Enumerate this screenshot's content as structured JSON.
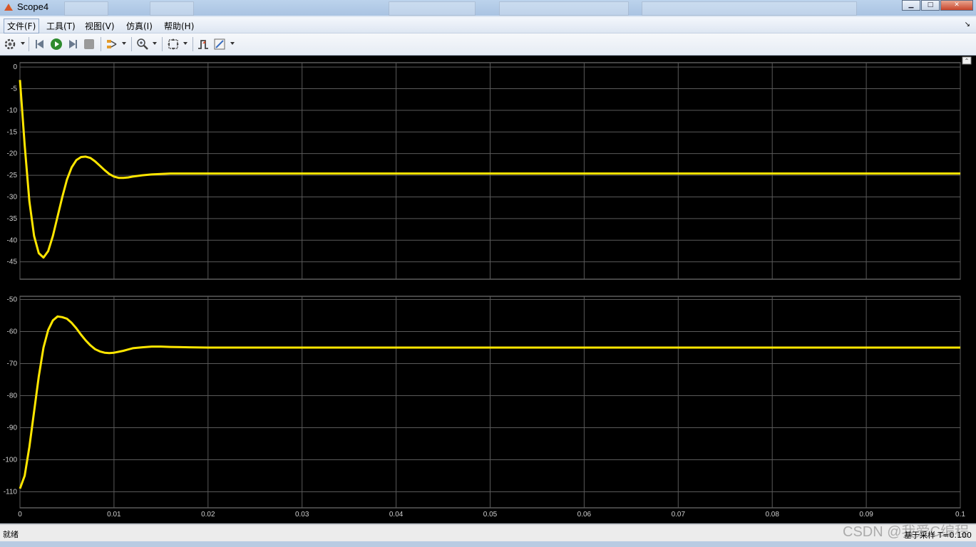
{
  "window": {
    "title": "Scope4"
  },
  "menus": [
    "文件(F)",
    "工具(T)",
    "视图(V)",
    "仿真(I)",
    "帮助(H)"
  ],
  "toolbar": {
    "icons": [
      "settings-icon",
      "step-back-icon",
      "run-icon",
      "step-forward-icon",
      "stop-icon",
      "highlight-signal-icon",
      "zoom-icon",
      "fit-to-view-icon",
      "trigger-icon",
      "measure-icon"
    ]
  },
  "status": {
    "left": "就绪",
    "right": "基于采样  T=0.100",
    "watermark": "CSDN @我爱C编程"
  },
  "colors": {
    "trace": "#ffe600",
    "background": "#000000",
    "grid": "#5a5a5a"
  },
  "chart_data": [
    {
      "type": "line",
      "xlim": [
        0,
        0.1
      ],
      "ylim": [
        -49,
        1
      ],
      "yticks": [
        "0",
        "-5",
        "-10",
        "-15",
        "-20",
        "-25",
        "-30",
        "-35",
        "-40",
        "-45"
      ],
      "xticks": [],
      "grid": true,
      "series": [
        {
          "x": [
            0,
            0.0005,
            0.001,
            0.0015,
            0.002,
            0.0025,
            0.003,
            0.0035,
            0.004,
            0.0045,
            0.005,
            0.0055,
            0.006,
            0.0065,
            0.007,
            0.0075,
            0.008,
            0.0085,
            0.009,
            0.0095,
            0.01,
            0.0105,
            0.011,
            0.0115,
            0.012,
            0.013,
            0.014,
            0.015,
            0.016,
            0.018,
            0.02,
            0.025,
            0.03,
            0.04,
            0.05,
            0.06,
            0.07,
            0.08,
            0.09,
            0.1
          ],
          "values": [
            -3,
            -18,
            -31,
            -39,
            -43,
            -44,
            -42.5,
            -39,
            -34.5,
            -30,
            -26,
            -23.2,
            -21.5,
            -20.8,
            -20.7,
            -21,
            -21.8,
            -22.8,
            -23.8,
            -24.7,
            -25.3,
            -25.6,
            -25.6,
            -25.5,
            -25.3,
            -25.0,
            -24.8,
            -24.7,
            -24.6,
            -24.6,
            -24.6,
            -24.6,
            -24.6,
            -24.6,
            -24.6,
            -24.6,
            -24.6,
            -24.6,
            -24.6,
            -24.6
          ]
        }
      ]
    },
    {
      "type": "line",
      "xlim": [
        0,
        0.1
      ],
      "ylim": [
        -115,
        -49
      ],
      "yticks": [
        "-50",
        "-60",
        "-70",
        "-80",
        "-90",
        "-100",
        "-110"
      ],
      "xticks": [
        "0",
        "0.01",
        "0.02",
        "0.03",
        "0.04",
        "0.05",
        "0.06",
        "0.07",
        "0.08",
        "0.09",
        "0.1"
      ],
      "grid": true,
      "series": [
        {
          "x": [
            0,
            0.0005,
            0.001,
            0.0015,
            0.002,
            0.0025,
            0.003,
            0.0035,
            0.004,
            0.0045,
            0.005,
            0.0055,
            0.006,
            0.0065,
            0.007,
            0.0075,
            0.008,
            0.0085,
            0.009,
            0.0095,
            0.01,
            0.0105,
            0.011,
            0.0115,
            0.012,
            0.013,
            0.014,
            0.015,
            0.016,
            0.018,
            0.02,
            0.025,
            0.03,
            0.04,
            0.05,
            0.06,
            0.07,
            0.08,
            0.09,
            0.1
          ],
          "values": [
            -109,
            -105,
            -96,
            -85,
            -74,
            -65,
            -59.5,
            -56.5,
            -55.3,
            -55.5,
            -56,
            -57.3,
            -59,
            -61,
            -62.8,
            -64.3,
            -65.5,
            -66.2,
            -66.6,
            -66.7,
            -66.6,
            -66.3,
            -66.0,
            -65.6,
            -65.2,
            -64.9,
            -64.7,
            -64.7,
            -64.8,
            -64.9,
            -65.0,
            -65.0,
            -65.0,
            -65.0,
            -65.0,
            -65.0,
            -65.0,
            -65.0,
            -65.0,
            -65.0
          ]
        }
      ]
    }
  ]
}
